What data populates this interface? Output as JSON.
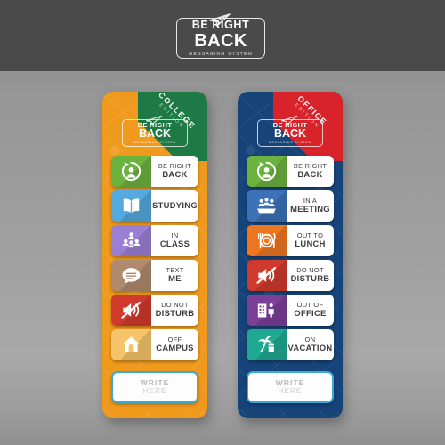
{
  "header": {
    "logo": {
      "line1": "BE RIGHT",
      "line2": "BACK",
      "tagline": "MESSAGING SYSTEM",
      "plane_icon": "paper-plane-icon"
    },
    "bar_color": "#4a4a4a"
  },
  "background": {
    "top_color": "#4a4a4a",
    "gradient_from": "#8e8e8e",
    "gradient_to": "#8f8f8f"
  },
  "cards": [
    {
      "id": "college",
      "card_color": "#f09a1d",
      "ribbon": {
        "line1": "COLLEGE",
        "line2": "EDITION",
        "color": "#1d7a45"
      },
      "logo": {
        "line1": "BE RIGHT",
        "line2": "BACK",
        "tagline": "MESSAGING SYSTEM"
      },
      "buttons": [
        {
          "line1": "BE RIGHT",
          "line2": "BACK",
          "color": "#6cb23f",
          "icon": "person-refresh-icon"
        },
        {
          "line1": "",
          "line2": "STUDYING",
          "color": "#54a9e0",
          "icon": "open-book-icon"
        },
        {
          "line1": "IN",
          "line2": "CLASS",
          "color": "#9b7fd4",
          "icon": "classroom-people-icon"
        },
        {
          "line1": "TEXT",
          "line2": "ME",
          "color": "#b08a6e",
          "icon": "chat-bubble-icon"
        },
        {
          "line1": "DO NOT",
          "line2": "DISTURB",
          "color": "#d03a2c",
          "icon": "muted-speaker-icon"
        },
        {
          "line1": "OFF",
          "line2": "CAMPUS",
          "color": "#f5c46a",
          "icon": "house-icon"
        }
      ],
      "write": {
        "line1": "WRITE",
        "line2": "HERE",
        "border_color": "#3aa9d6"
      }
    },
    {
      "id": "office",
      "card_color": "#164479",
      "ribbon": {
        "line1": "OFFICE",
        "line2": "EDITION",
        "color": "#d8232a"
      },
      "logo": {
        "line1": "BE RIGHT",
        "line2": "BACK",
        "tagline": "MESSAGING SYSTEM"
      },
      "buttons": [
        {
          "line1": "BE RIGHT",
          "line2": "BACK",
          "color": "#6cb23f",
          "icon": "person-refresh-icon"
        },
        {
          "line1": "IN A",
          "line2": "MEETING",
          "color": "#3d72b8",
          "icon": "meeting-people-icon"
        },
        {
          "line1": "OUT TO",
          "line2": "LUNCH",
          "color": "#ef7621",
          "icon": "plate-cutlery-icon"
        },
        {
          "line1": "DO NOT",
          "line2": "DISTURB",
          "color": "#d03a2c",
          "icon": "muted-speaker-icon"
        },
        {
          "line1": "OUT OF",
          "line2": "OFFICE",
          "color": "#7b3f98",
          "icon": "office-building-icon"
        },
        {
          "line1": "ON",
          "line2": "VACATION",
          "color": "#1fa992",
          "icon": "palm-beach-icon"
        }
      ],
      "write": {
        "line1": "WRITE",
        "line2": "HERE",
        "border_color": "#3aa9d6"
      }
    }
  ]
}
